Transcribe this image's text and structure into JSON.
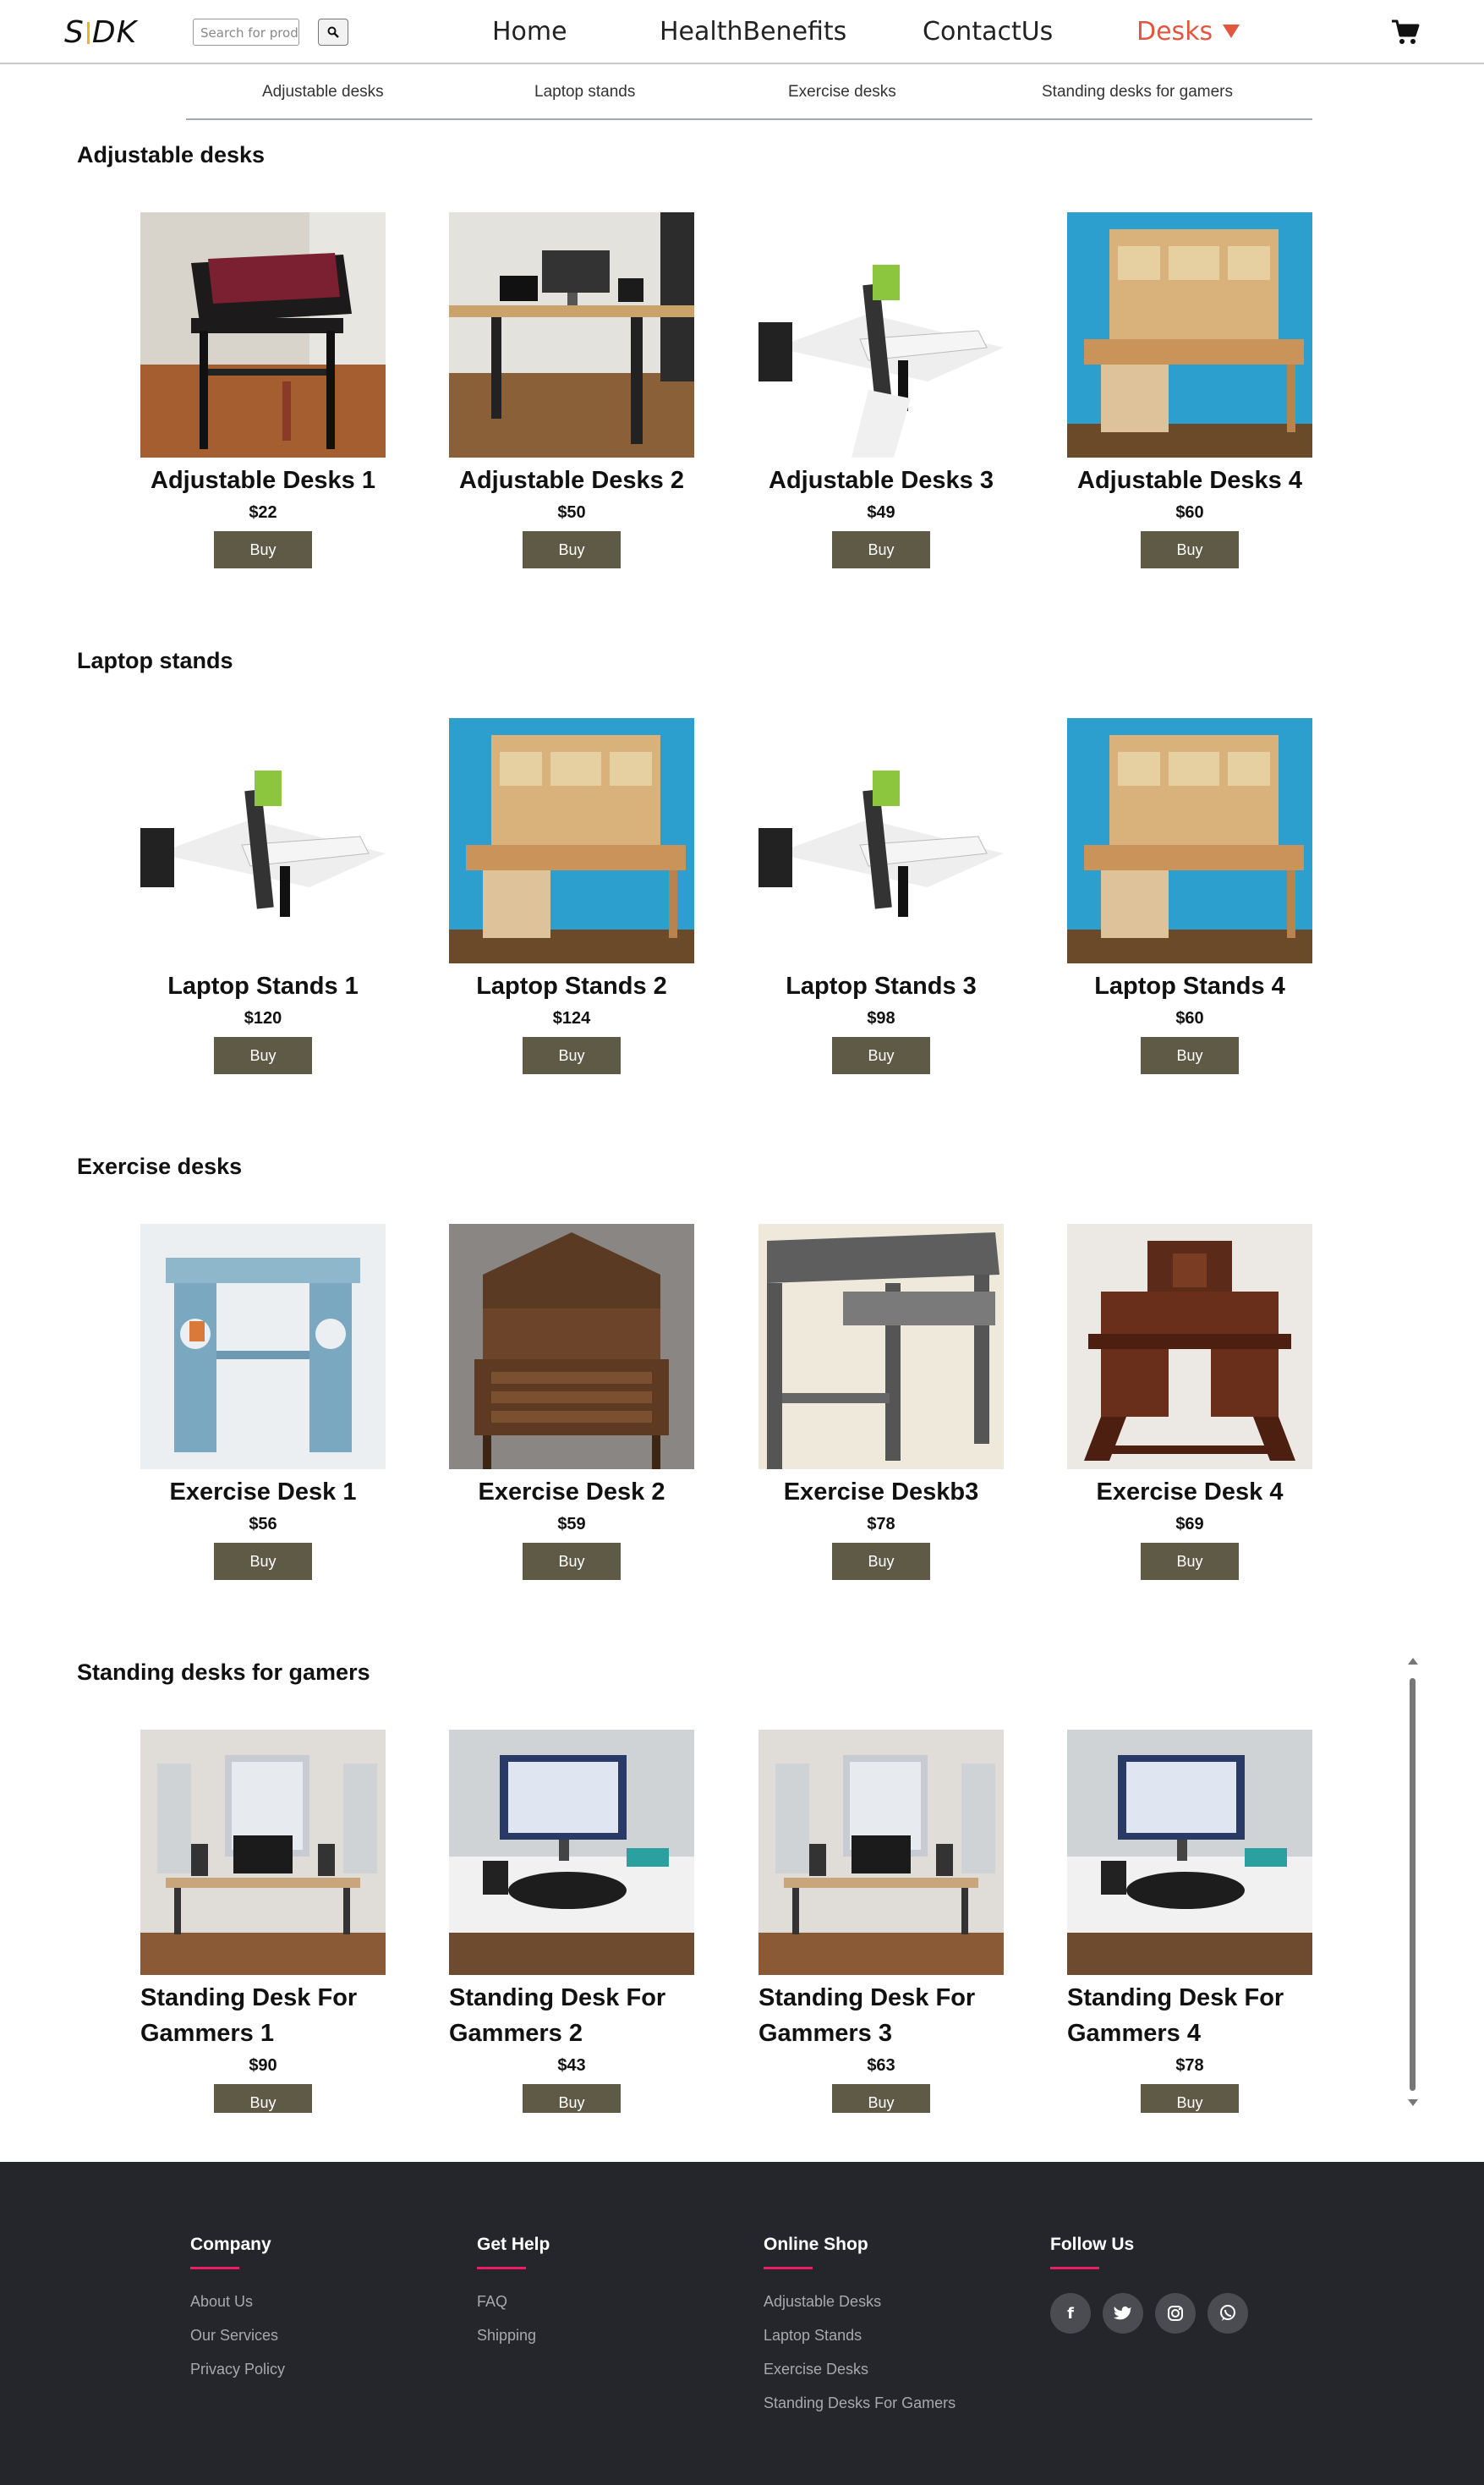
{
  "header": {
    "logo_left": "S",
    "logo_right": "DK",
    "search_placeholder": "Search for products",
    "nav": [
      "Home",
      "HealthBenefits",
      "ContactUs",
      "Desks"
    ]
  },
  "subnav": [
    "Adjustable desks",
    "Laptop stands",
    "Exercise desks",
    "Standing desks for gamers"
  ],
  "buy_label": "Buy",
  "sections": [
    {
      "title": "Adjustable desks",
      "products": [
        {
          "name": "Adjustable Desks 1",
          "price": "$22"
        },
        {
          "name": "Adjustable Desks 2",
          "price": "$50"
        },
        {
          "name": "Adjustable Desks 3",
          "price": "$49"
        },
        {
          "name": "Adjustable Desks 4",
          "price": "$60"
        }
      ]
    },
    {
      "title": "Laptop stands",
      "products": [
        {
          "name": "Laptop Stands 1",
          "price": "$120"
        },
        {
          "name": "Laptop Stands 2",
          "price": "$124"
        },
        {
          "name": "Laptop Stands 3",
          "price": "$98"
        },
        {
          "name": "Laptop Stands 4",
          "price": "$60"
        }
      ]
    },
    {
      "title": "Exercise desks",
      "products": [
        {
          "name": "Exercise Desk 1",
          "price": "$56"
        },
        {
          "name": "Exercise Desk 2",
          "price": "$59"
        },
        {
          "name": "Exercise Deskb3",
          "price": "$78"
        },
        {
          "name": "Exercise Desk 4",
          "price": "$69"
        }
      ]
    },
    {
      "title": "Standing desks for gamers",
      "products": [
        {
          "name": "Standing Desk For Gammers 1",
          "price": "$90"
        },
        {
          "name": "Standing Desk For Gammers 2",
          "price": "$43"
        },
        {
          "name": "Standing Desk For Gammers 3",
          "price": "$63"
        },
        {
          "name": "Standing Desk For Gammers 4",
          "price": "$78"
        }
      ]
    }
  ],
  "footer": {
    "company": {
      "title": "Company",
      "links": [
        "About Us",
        "Our Services",
        "Privacy Policy"
      ]
    },
    "help": {
      "title": "Get Help",
      "links": [
        "FAQ",
        "Shipping"
      ]
    },
    "shop": {
      "title": "Online Shop",
      "links": [
        "Adjustable Desks",
        "Laptop Stands",
        "Exercise Desks",
        "Standing Desks For Gamers"
      ]
    },
    "follow": {
      "title": "Follow Us",
      "icons": [
        "facebook-icon",
        "twitter-icon",
        "instagram-icon",
        "whatsapp-icon"
      ]
    }
  },
  "colors": {
    "accent": "#e2553f",
    "buy_button": "#5f5a46",
    "footer_bg": "#24262c",
    "footer_underline": "#e91e63"
  }
}
